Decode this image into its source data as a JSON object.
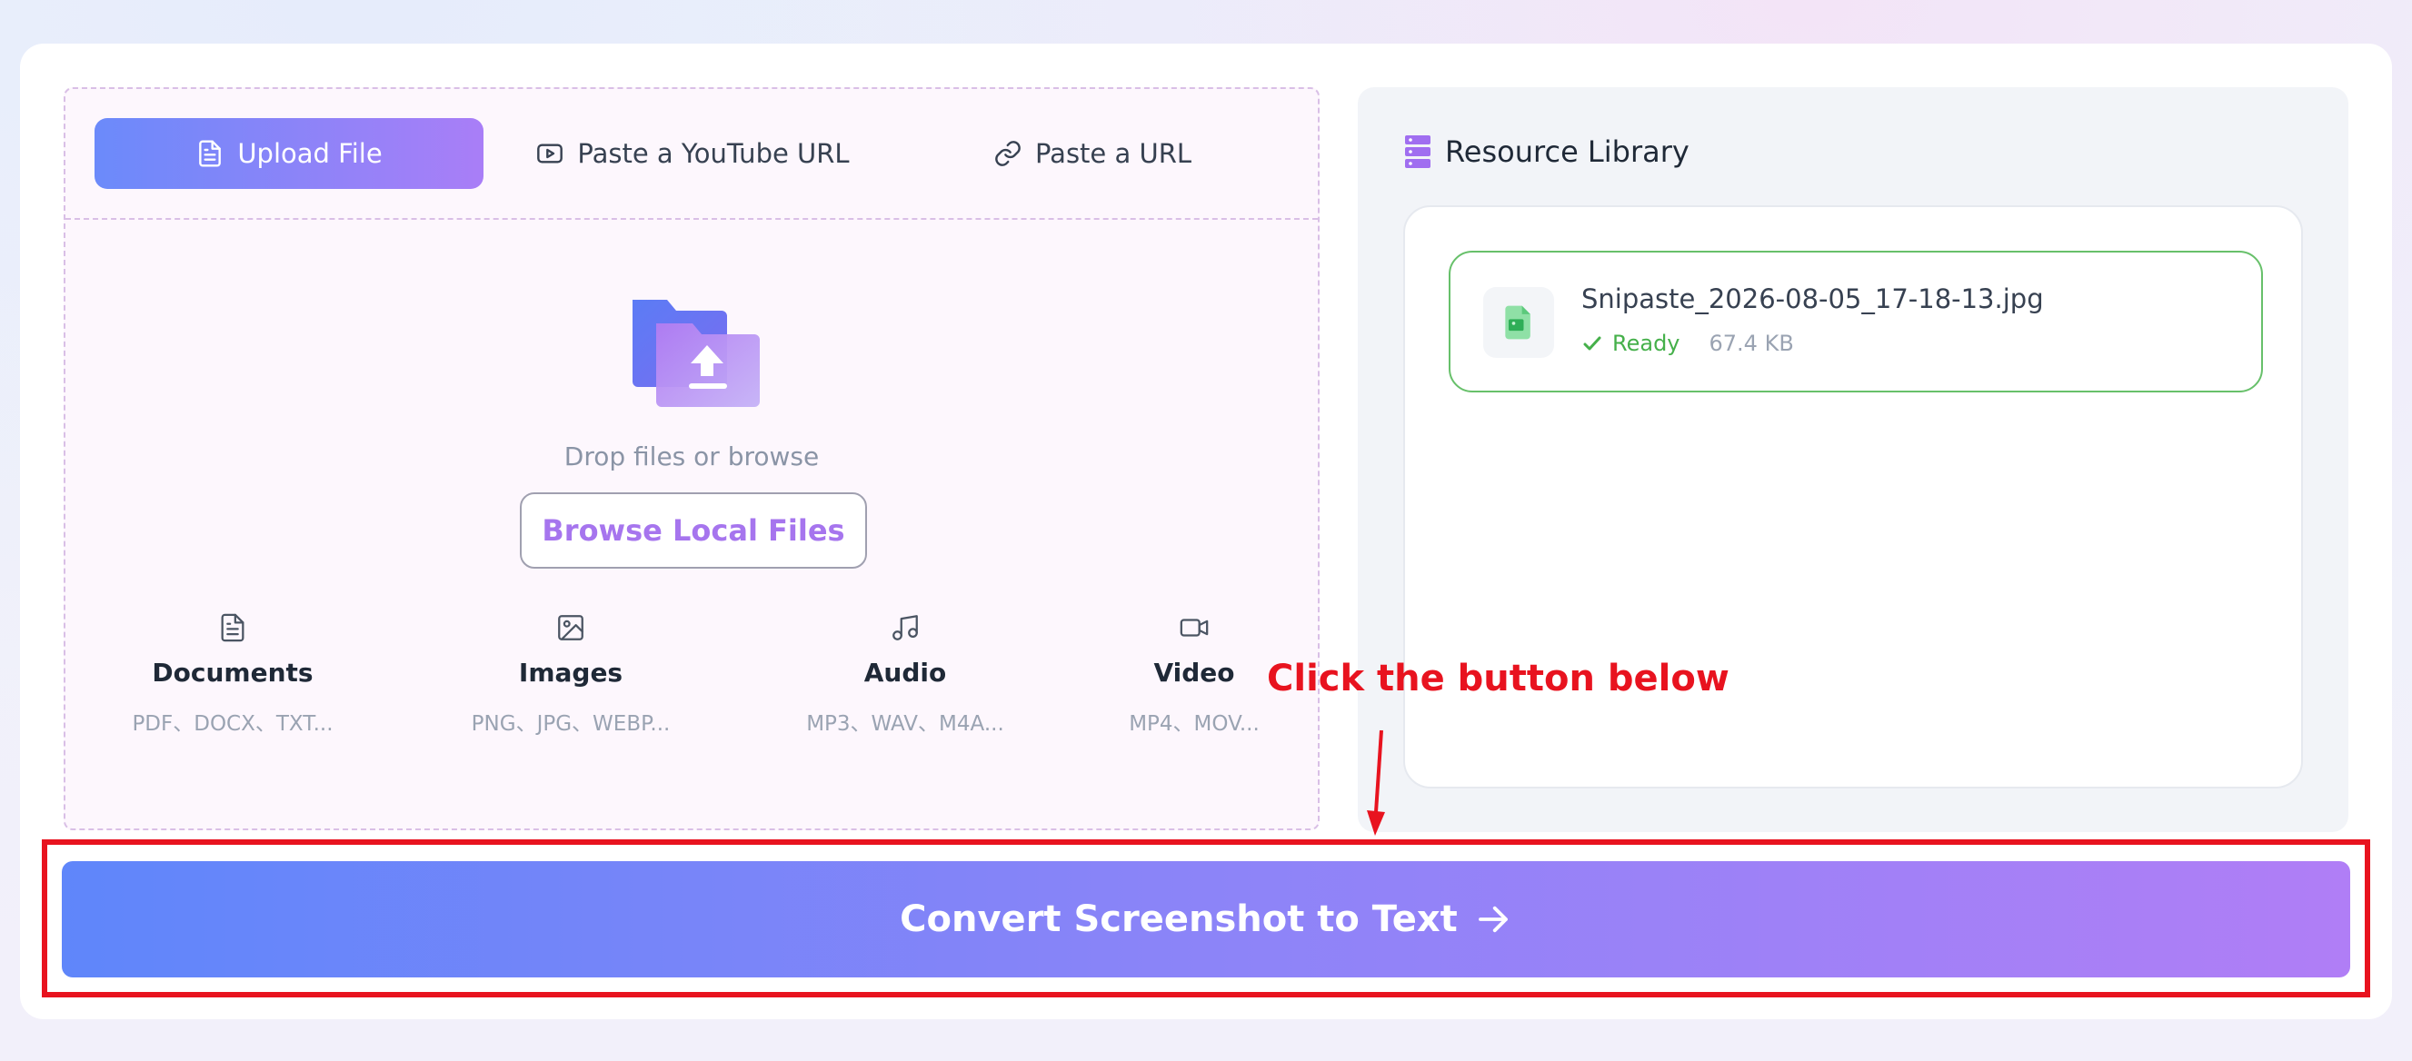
{
  "tabs": [
    {
      "label": "Upload File",
      "icon": "document-icon",
      "active": true
    },
    {
      "label": "Paste a YouTube URL",
      "icon": "youtube-icon",
      "active": false
    },
    {
      "label": "Paste a URL",
      "icon": "link-icon",
      "active": false
    }
  ],
  "dropzone": {
    "icon": "folder-upload-icon",
    "text": "Drop files or browse",
    "browse_label": "Browse Local Files"
  },
  "file_types": [
    {
      "name": "Documents",
      "extensions": "PDF、DOCX、TXT...",
      "icon": "document-icon"
    },
    {
      "name": "Images",
      "extensions": "PNG、JPG、WEBP...",
      "icon": "image-icon"
    },
    {
      "name": "Audio",
      "extensions": "MP3、WAV、M4A...",
      "icon": "music-icon"
    },
    {
      "name": "Video",
      "extensions": "MP4、MOV...",
      "icon": "video-icon"
    }
  ],
  "library": {
    "title": "Resource Library",
    "icon": "server-icon",
    "files": [
      {
        "name": "Snipaste_2026-08-05_17-18-13.jpg",
        "status": "Ready",
        "size": "67.4 KB",
        "icon": "image-file-icon"
      }
    ]
  },
  "annotation": {
    "text": "Click the button below",
    "color": "#e8131f"
  },
  "convert_button": {
    "label": "Convert Screenshot to Text",
    "icon": "arrow-right-icon"
  },
  "colors": {
    "accent_start": "#5f86fa",
    "accent_end": "#b07ef6",
    "ready": "#45b04a",
    "annotation_red": "#e8131f"
  }
}
